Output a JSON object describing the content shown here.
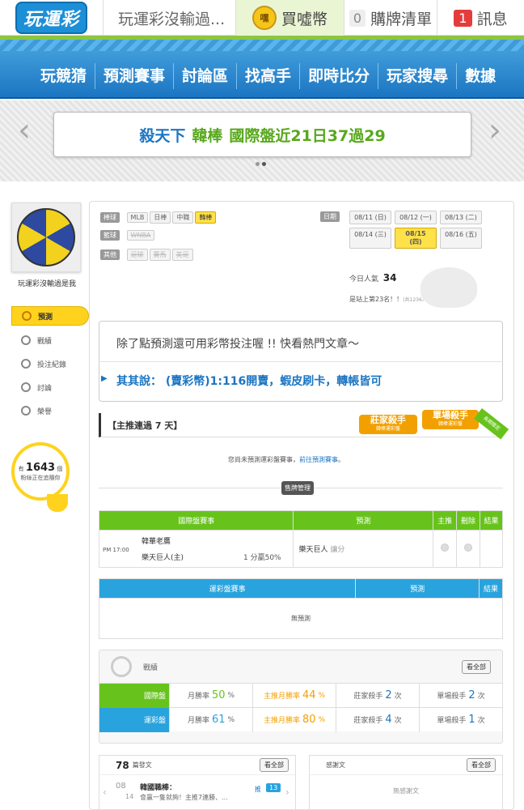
{
  "topbar": {
    "logo": "玩運彩",
    "title": "玩運彩沒輸過...",
    "coin_icon": "嘿",
    "coin_label": "買噓幣",
    "cart_count": "0",
    "cart_label": "購牌清單",
    "msg_count": "1",
    "msg_label": "訊息"
  },
  "nav": [
    "玩競猜",
    "預測賽事",
    "討論區",
    "找高手",
    "即時比分",
    "玩家搜尋",
    "數據"
  ],
  "banner": {
    "prefix": "殺天下",
    "team": "韓棒",
    "suffix": "國際盤近21日37過29"
  },
  "profile": {
    "name": "玩運彩沒輸過是我",
    "menu": [
      "預測",
      "戰績",
      "投注紀錄",
      "討論",
      "榮譽"
    ],
    "fans_pre": "有",
    "fans_count": "1643",
    "fans_unit": "個",
    "fans_post": "粉絲正在追隨你"
  },
  "filters": {
    "baseball_label": "棒球",
    "baseball": [
      "MLB",
      "日棒",
      "中職",
      "韓棒"
    ],
    "basketball_label": "籃球",
    "basketball": [
      "WNBA"
    ],
    "other_label": "其他",
    "other": [
      "足球",
      "賽馬",
      "美足"
    ],
    "date_label": "日期",
    "dates": [
      "08/11 (日)",
      "08/12 (一)",
      "08/13 (二)",
      "08/14 (三)",
      "08/15 (四)",
      "08/16 (五)"
    ],
    "popularity_label": "今日人氣",
    "popularity": "34",
    "rank_text": "是站上第23名！！",
    "rank_sub": "(共1236人)"
  },
  "promo": {
    "line1": "除了點預測還可用彩幣投注喔 !! 快看熱門文章～",
    "line2": "其其說： (賣彩幣)1:116開賣，蝦皮刷卡，轉帳皆可"
  },
  "section": {
    "title": "【主推連過 7 天】",
    "badge1": "莊家殺手",
    "badge1_sub": "韓棒運彩盤",
    "badge2": "單場殺手",
    "badge2_sub": "韓棒運彩盤",
    "badge3": "長期穩定",
    "note": "您尚未預測運彩盤賽事，",
    "note_link": "前往預測賽事",
    "note_end": "。",
    "manage": "售牌管理"
  },
  "intl_table": {
    "headers": [
      "國際盤賽事",
      "預測",
      "主推",
      "刪除",
      "結果"
    ],
    "time": "PM 17:00",
    "team1": "韓華老鷹",
    "team2": "樂天巨人(主)",
    "line": "1 分贏50%",
    "pick": "樂天巨人",
    "pick_type": "讓分"
  },
  "sport_table": {
    "headers": [
      "運彩盤賽事",
      "預測",
      "結果"
    ],
    "empty": "無預測"
  },
  "stats": {
    "title": "戰績",
    "button": "看全部",
    "rows": [
      {
        "label": "國際盤",
        "month_label": "月勝率",
        "month": "50",
        "main_label": "主推月勝率",
        "main": "44",
        "pct": "%",
        "house_label": "莊家殺手",
        "house": "2",
        "single_label": "單場殺手",
        "single": "2",
        "unit": "次"
      },
      {
        "label": "運彩盤",
        "month_label": "月勝率",
        "month": "61",
        "main_label": "主推月勝率",
        "main": "80",
        "pct": "%",
        "house_label": "莊家殺手",
        "house": "4",
        "single_label": "單場殺手",
        "single": "1",
        "unit": "次"
      }
    ]
  },
  "posts": {
    "count": "78",
    "label": "篇發文",
    "button": "看全部",
    "day1": "08",
    "day2": "14",
    "post_title": "韓國職棒：",
    "post_desc": "會贏一隻就夠！主推7連勝、...",
    "push": "推",
    "push_count": "13"
  },
  "thanks": {
    "label": "感謝文",
    "button": "看全部",
    "empty": "無感謝文"
  },
  "colors": {
    "accent_green": "#8cc63f",
    "nav_blue": "#1b75c2",
    "highlight": "#ffd31d",
    "table_green": "#67c31c",
    "table_blue": "#29a3dd"
  }
}
